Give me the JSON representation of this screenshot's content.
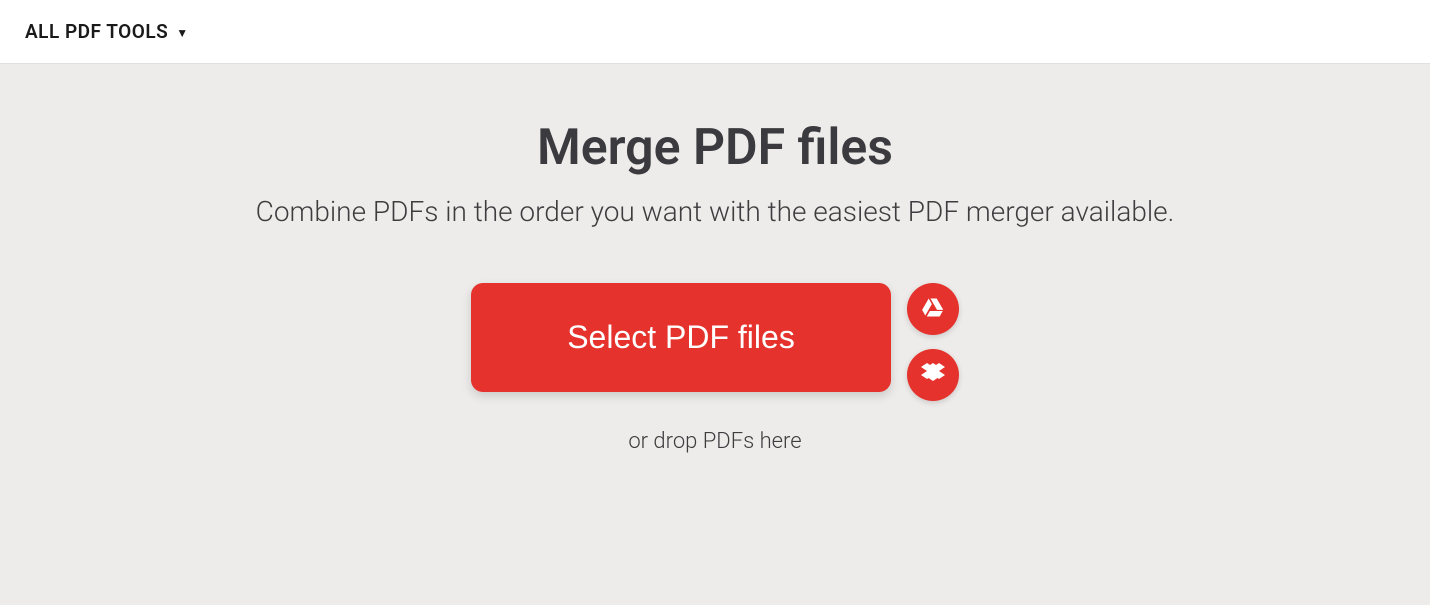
{
  "header": {
    "dropdown_label": "ALL PDF TOOLS"
  },
  "main": {
    "title": "Merge PDF files",
    "subtitle": "Combine PDFs in the order you want with the easiest PDF merger available.",
    "select_button_label": "Select PDF files",
    "drop_hint": "or drop PDFs here"
  },
  "colors": {
    "accent": "#e5322d",
    "background": "#eeecea"
  }
}
